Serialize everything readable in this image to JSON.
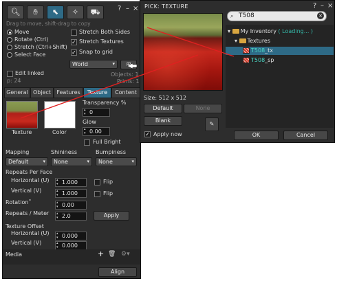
{
  "build": {
    "hint": "Drag to move, shift-drag to copy",
    "header_question": "?",
    "header_minimize": "–",
    "header_close": "×",
    "modes": [
      {
        "label": "Move",
        "selected": true
      },
      {
        "label": "Rotate (Ctrl)",
        "selected": false
      },
      {
        "label": "Stretch (Ctrl+Shift)",
        "selected": false
      },
      {
        "label": "Select Face",
        "selected": false
      }
    ],
    "stretch_both_sides": {
      "label": "Stretch Both Sides",
      "checked": false
    },
    "stretch_textures": {
      "label": "Stretch Textures",
      "checked": true
    },
    "snap_to_grid": {
      "label": "Snap to grid",
      "checked": true
    },
    "grid_mode": "World",
    "edit_linked": {
      "label": "Edit linked",
      "checked": false
    },
    "objects": "Objects: 1",
    "prims": "Prims: 1",
    "land": "p: 24",
    "tabs": [
      "General",
      "Object",
      "Features",
      "Texture",
      "Content"
    ],
    "texture_label": "Texture",
    "color_label": "Color",
    "transparency_label": "Transparency %",
    "transparency_value": "0",
    "glow_label": "Glow",
    "glow_value": "0.00",
    "full_bright": {
      "label": "Full Bright",
      "checked": false
    },
    "mapping_label": "Mapping",
    "mapping_value": "Default",
    "shininess_label": "Shininess",
    "shininess_value": "None",
    "bumpiness_label": "Bumpiness",
    "bumpiness_value": "None",
    "repeats_per_face": "Repeats Per Face",
    "horizontal_label": "Horizontal (U)",
    "horizontal_value": "1.000",
    "vertical_label": "Vertical (V)",
    "vertical_value": "1.000",
    "flip_label": "Flip",
    "rotation_label": "Rotation˚",
    "rotation_value": "0.00",
    "repeats_meter_label": "Repeats / Meter",
    "repeats_meter_value": "2.0",
    "apply_label": "Apply",
    "offset_label": "Texture Offset",
    "offset_h_label": "Horizontal (U)",
    "offset_h_value": "0.000",
    "offset_v_label": "Vertical (V)",
    "offset_v_value": "0.000",
    "media_label": "Media",
    "add_icon": "+",
    "delete_icon": "trash-icon",
    "align_label": "Align"
  },
  "picker": {
    "title": "PICK: TEXTURE",
    "question": "?",
    "minimize": "–",
    "close": "×",
    "search_value": "T508",
    "size_label": "Size: 512 x 512",
    "default_label": "Default",
    "none_label": "None",
    "blank_label": "Blank",
    "apply_now": {
      "label": "Apply now",
      "checked": true
    },
    "ok_label": "OK",
    "cancel_label": "Cancel",
    "tree": {
      "root": "My Inventory",
      "root_status": "( Loading... )",
      "folder": "Textures",
      "items": [
        {
          "hl": "T508",
          "rest": "_tx",
          "selected": true
        },
        {
          "hl": "T508",
          "rest": "_sp",
          "selected": false
        }
      ]
    }
  },
  "colors": {
    "panel_bg": "#2d2d2d",
    "accent": "#2e6a86",
    "highlight_text": "#4ad8c6",
    "arrow_red": "#e02020"
  }
}
